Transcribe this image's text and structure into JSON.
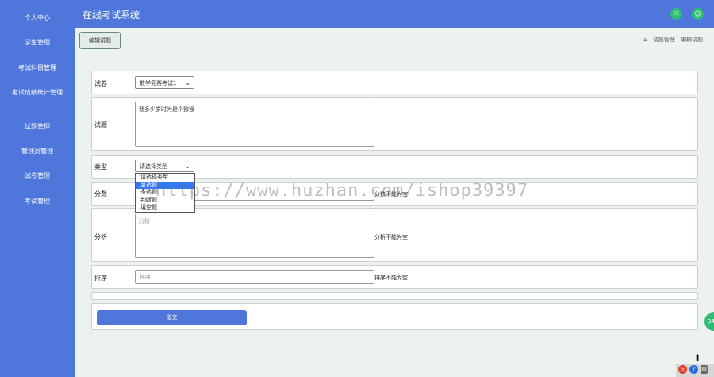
{
  "app": {
    "title": "在线考试系统"
  },
  "sidebar": {
    "items": [
      {
        "label": "个人中心"
      },
      {
        "label": "学生管理"
      },
      {
        "label": "考试科目管理"
      },
      {
        "label": "考试成绩统计管理"
      },
      {
        "label": "试题管理"
      },
      {
        "label": "管理员管理"
      },
      {
        "label": "试卷管理"
      },
      {
        "label": "考试管理"
      }
    ]
  },
  "header_icons": [
    "expand-icon",
    "user-icon"
  ],
  "breadcrumb": {
    "button": "编辑试题",
    "path": [
      "试题管理",
      "编辑试题"
    ]
  },
  "form": {
    "paper": {
      "label": "试卷",
      "value": "数学竞赛考试1"
    },
    "question": {
      "label": "试题",
      "value": "我多少岁时为是个猕猴"
    },
    "type": {
      "label": "类型",
      "value": "请选择类型",
      "options": [
        "请选择类型",
        "单选题",
        "多选题",
        "判断题",
        "填空题"
      ],
      "highlighted": "单选题"
    },
    "score": {
      "label": "分数",
      "error": "分数不能为空"
    },
    "analysis": {
      "label": "分析",
      "placeholder": "分析",
      "error": "分析不能为空"
    },
    "order": {
      "label": "排序",
      "placeholder": "排序",
      "error": "排序不能为空"
    },
    "submit": "提交"
  },
  "watermark": "https://www.huzhan.com/ishop39397",
  "colors": {
    "primary": "#4f76db",
    "accent": "#2dbe74",
    "background": "#eef2ee"
  }
}
